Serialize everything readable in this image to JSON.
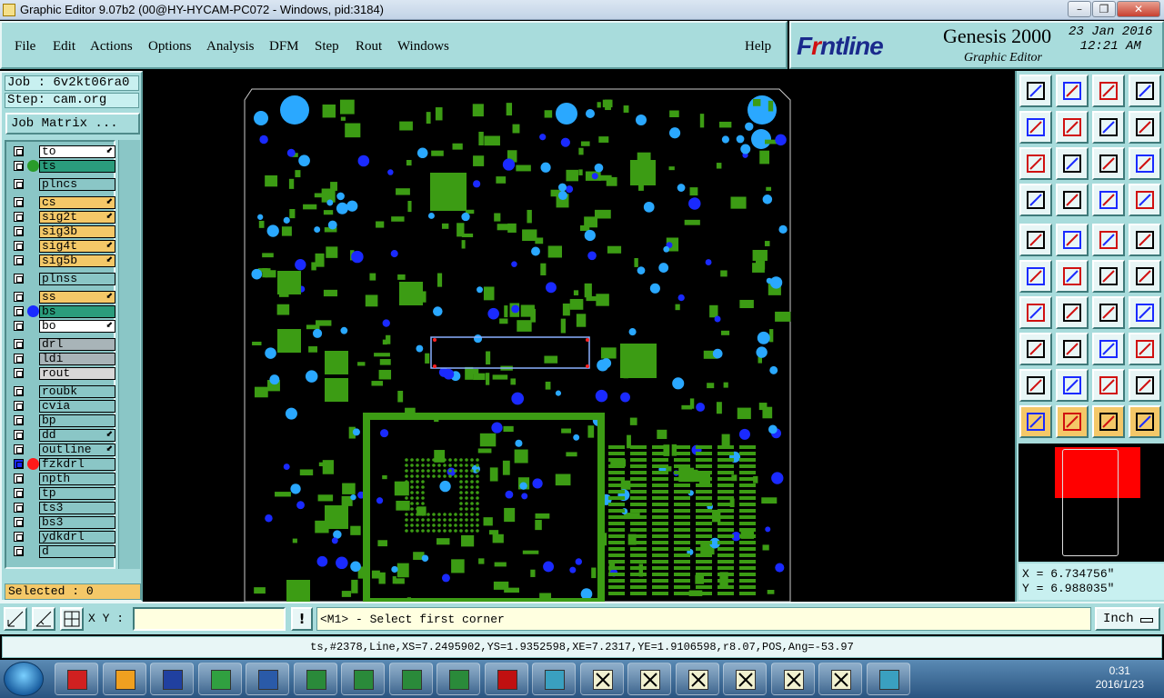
{
  "window": {
    "title": "Graphic Editor 9.07b2 (00@HY-HYCAM-PC072 - Windows, pid:3184)"
  },
  "menu": [
    {
      "label": "File",
      "key": "F"
    },
    {
      "label": "Edit",
      "key": "E"
    },
    {
      "label": "Actions",
      "key": "A"
    },
    {
      "label": "Options",
      "key": "O"
    },
    {
      "label": "Analysis",
      "key": "A"
    },
    {
      "label": "DFM",
      "key": "D"
    },
    {
      "label": "Step",
      "key": "S"
    },
    {
      "label": "Rout",
      "key": "R"
    },
    {
      "label": "Windows",
      "key": "W"
    },
    {
      "label": "Help",
      "key": ""
    }
  ],
  "brand": {
    "logo_pre": "F",
    "logo_mid": "r",
    "logo_post": "ntline",
    "product": "Genesis 2000",
    "subtitle": "Graphic Editor",
    "date": "23 Jan 2016",
    "time": "12:21 AM"
  },
  "job": {
    "job": "Job : 6v2kt06ra0",
    "step": "Step: cam.org",
    "matrix_button": "Job Matrix ..."
  },
  "layers": [
    {
      "name": "to",
      "color": "#ffffff",
      "dot": "",
      "arrow": true
    },
    {
      "name": "ts",
      "color": "#2a9c7c",
      "dot": "#2a9c2a",
      "arrow": false
    },
    {
      "name": "plncs",
      "color": "#8ac6c6",
      "dot": "",
      "arrow": false,
      "gap": true
    },
    {
      "name": "cs",
      "color": "#f4c868",
      "dot": "",
      "arrow": true,
      "gap": true
    },
    {
      "name": "sig2t",
      "color": "#f4c868",
      "dot": "",
      "arrow": true
    },
    {
      "name": "sig3b",
      "color": "#f4c868",
      "dot": "",
      "arrow": false
    },
    {
      "name": "sig4t",
      "color": "#f4c868",
      "dot": "",
      "arrow": true
    },
    {
      "name": "sig5b",
      "color": "#f4c868",
      "dot": "",
      "arrow": true
    },
    {
      "name": "plnss",
      "color": "#8ac6c6",
      "dot": "",
      "arrow": false,
      "gap": true
    },
    {
      "name": "ss",
      "color": "#f4c868",
      "dot": "",
      "arrow": true,
      "gap": true
    },
    {
      "name": "bs",
      "color": "#2a9c7c",
      "dot": "#1a2aff",
      "arrow": false
    },
    {
      "name": "bo",
      "color": "#ffffff",
      "dot": "",
      "arrow": true
    },
    {
      "name": "drl",
      "color": "#a8b4b8",
      "dot": "",
      "arrow": false,
      "gap": true
    },
    {
      "name": "ldi",
      "color": "#a8b4b8",
      "dot": "",
      "arrow": false
    },
    {
      "name": "rout",
      "color": "#d8d8d8",
      "dot": "",
      "arrow": false
    },
    {
      "name": "roubk",
      "color": "#8ac6c6",
      "dot": "",
      "arrow": false,
      "gap": true
    },
    {
      "name": "cvia",
      "color": "#8ac6c6",
      "dot": "",
      "arrow": false
    },
    {
      "name": "bp",
      "color": "#8ac6c6",
      "dot": "",
      "arrow": false
    },
    {
      "name": "dd",
      "color": "#8ac6c6",
      "dot": "",
      "arrow": true
    },
    {
      "name": "outline",
      "color": "#8ac6c6",
      "dot": "",
      "arrow": true
    },
    {
      "name": "fzkdrl",
      "color": "#8ac6c6",
      "dot": "#ff1a1a",
      "arrow": false,
      "active": true
    },
    {
      "name": "npth",
      "color": "#8ac6c6",
      "dot": "",
      "arrow": false
    },
    {
      "name": "tp",
      "color": "#8ac6c6",
      "dot": "",
      "arrow": false
    },
    {
      "name": "ts3",
      "color": "#8ac6c6",
      "dot": "",
      "arrow": false
    },
    {
      "name": "bs3",
      "color": "#8ac6c6",
      "dot": "",
      "arrow": false
    },
    {
      "name": "ydkdrl",
      "color": "#8ac6c6",
      "dot": "",
      "arrow": false
    },
    {
      "name": "d",
      "color": "#8ac6c6",
      "dot": "",
      "arrow": false
    }
  ],
  "selected": "Selected : 0",
  "coords": {
    "x": "X = 6.734756\"",
    "y": "Y = 6.988035\""
  },
  "xy_label": "X Y :",
  "xy_value": "",
  "prompt": "<M1> - Select first corner",
  "units": "Inch",
  "status": "ts,#2378,Line,XS=7.2495902,YS=1.9352598,XE=7.2317,YE=1.9106598,r8.07,POS,Ang=-53.97",
  "clock": {
    "time": "0:31",
    "date": "2016/1/23"
  },
  "colors": {
    "copper": "#3c9c14",
    "via": "#1a2aff",
    "pad": "#2aa8ff",
    "panel": "#a8dcdc"
  },
  "toolbar_icons": [
    "reset-icon",
    "save-icon",
    "home-icon",
    "grid-icon",
    "zoom-in-icon",
    "zoom-out-icon",
    "swap-icon",
    "swap-alt-icon",
    "fit-icon",
    "center-icon",
    "scale-icon",
    "query-icon",
    "snap-icon",
    "grid-toggle-icon",
    "graph-icon",
    "graph-alt-icon",
    "feature-icon",
    "mirror-icon",
    "measure-icon",
    "record-icon",
    "net-icon",
    "delete-icon",
    "move-icon",
    "copy-icon",
    "line-icon",
    "arc-icon",
    "undo-icon",
    "split-icon",
    "pad-icon",
    "edit-line-icon",
    "zoom-box-icon",
    "transform-icon",
    "triangle-icon",
    "select-a-icon",
    "select-b-icon",
    "select-c-icon",
    "pointer-icon",
    "pointer-alt-icon",
    "lasso-icon",
    "route-icon"
  ],
  "taskbar": [
    "start",
    "app-g",
    "shell",
    "save",
    "app-p",
    "word",
    "excel",
    "excel",
    "excel",
    "excel",
    "pdf",
    "eye",
    "ge1",
    "ge2",
    "ge3",
    "ge4",
    "ge5",
    "ge6",
    "eye2"
  ]
}
